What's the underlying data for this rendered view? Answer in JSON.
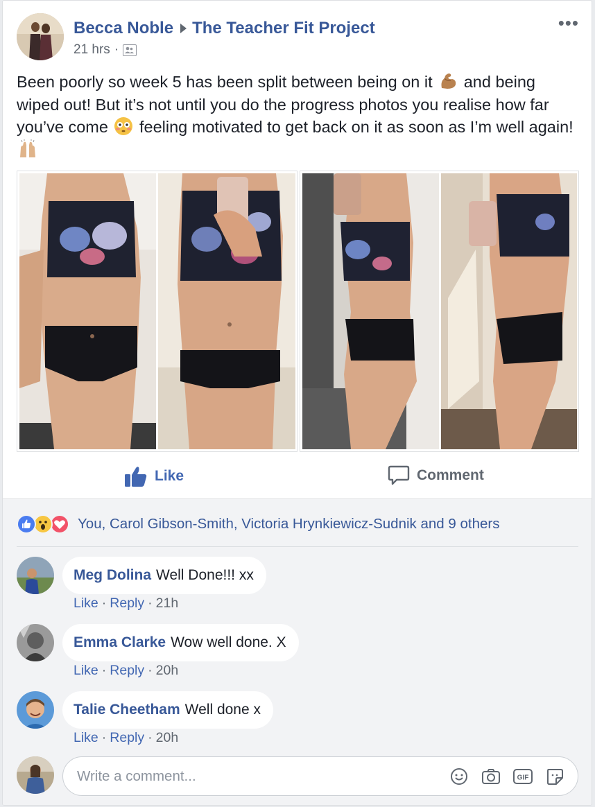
{
  "post": {
    "author": "Becca Noble",
    "group": "The Teacher Fit Project",
    "time": "21 hrs",
    "separator": "·",
    "text_parts": [
      "Been poorly so week 5 has been split between being on it ",
      " and being wiped out! But it’s not until you do the progress photos you realise how far you’ve come ",
      " feeling motivated to get back on it as soon as I’m well again! "
    ],
    "emojis": [
      "flexed-biceps-emoji",
      "flushed-face-emoji",
      "raised-hands-emoji"
    ]
  },
  "actions": {
    "like_label": "Like",
    "comment_label": "Comment"
  },
  "reactions": {
    "icons": [
      "like",
      "wow",
      "love"
    ],
    "summary": "You, Carol Gibson-Smith, Victoria Hrynkiewicz-Sudnik and 9 others"
  },
  "comments": [
    {
      "author": "Meg Dolina",
      "text": "Well Done!!! xx",
      "like": "Like",
      "reply": "Reply",
      "time": "21h"
    },
    {
      "author": "Emma Clarke",
      "text": "Wow well done. X",
      "like": "Like",
      "reply": "Reply",
      "time": "20h"
    },
    {
      "author": "Talie Cheetham",
      "text": "Well done x",
      "like": "Like",
      "reply": "Reply",
      "time": "20h"
    }
  ],
  "composer": {
    "placeholder": "Write a comment...",
    "tools": [
      "emoji-icon",
      "camera-icon",
      "gif-icon",
      "sticker-icon"
    ],
    "gif_label": "GIF"
  },
  "colors": {
    "link": "#385898",
    "accent": "#4267b2",
    "muted": "#606770",
    "background": "#f2f3f5"
  }
}
